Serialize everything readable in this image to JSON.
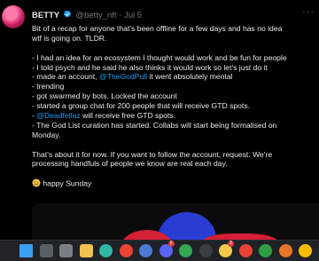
{
  "tweet": {
    "display_name": "BETTY",
    "handle": "@betty_nft",
    "separator": "·",
    "date": "Jul 5",
    "more_label": "···",
    "lines": [
      {
        "parts": [
          {
            "text": "Bit of a recap for anyone that's been offline for a few days and has no idea"
          }
        ]
      },
      {
        "parts": [
          {
            "text": "wtf is going on. TLDR."
          }
        ]
      },
      {
        "blank": true
      },
      {
        "parts": [
          {
            "text": "- I had an idea for an ecosystem I thought would work and be fun for people"
          }
        ]
      },
      {
        "parts": [
          {
            "text": "- I told psych and he said he also thinks it would work so let's just do it"
          }
        ]
      },
      {
        "parts": [
          {
            "text": "- made an account, "
          },
          {
            "text": "@TheGodPull",
            "mention": true
          },
          {
            "text": " it went absolutely mental"
          }
        ]
      },
      {
        "parts": [
          {
            "text": "- trending"
          }
        ]
      },
      {
        "parts": [
          {
            "text": "- got swarmed by bots. Locked the account"
          }
        ]
      },
      {
        "parts": [
          {
            "text": "- started a group chat for 200 people that will receive GTD spots."
          }
        ]
      },
      {
        "parts": [
          {
            "text": "- "
          },
          {
            "text": "@Deadfellaz",
            "mention": true
          },
          {
            "text": " will receive free GTD spots."
          }
        ]
      },
      {
        "parts": [
          {
            "text": "- The God List curation has started. Collabs will start being formalised on"
          }
        ]
      },
      {
        "parts": [
          {
            "text": "Monday."
          }
        ]
      },
      {
        "blank": true
      },
      {
        "parts": [
          {
            "text": "That's about it for now. If you want to follow the account, request. We're"
          }
        ]
      },
      {
        "parts": [
          {
            "text": "processing handfuls of people we know are real each day."
          }
        ]
      },
      {
        "blank": true
      },
      {
        "emoji": "smiling-face-emoji",
        "parts": [
          {
            "text": "happy Sunday"
          }
        ]
      }
    ]
  },
  "taskbar": {
    "icons": [
      {
        "name": "windows-start-icon",
        "color": "#3aa0f2",
        "badge": ""
      },
      {
        "name": "search-icon",
        "color": "#5a5f66",
        "badge": ""
      },
      {
        "name": "task-view-icon",
        "color": "#7a7f86",
        "badge": ""
      },
      {
        "name": "file-explorer-icon",
        "color": "#f2c14e",
        "badge": ""
      },
      {
        "name": "edge-browser-icon",
        "color": "#2fb8a3",
        "badge": ""
      },
      {
        "name": "chrome-browser-icon",
        "color": "#ea4335",
        "badge": ""
      },
      {
        "name": "app-icon-blue",
        "color": "#4a7bd6",
        "badge": ""
      },
      {
        "name": "discord-icon",
        "color": "#5865f2",
        "badge": "9"
      },
      {
        "name": "chrome-profile-icon",
        "color": "#34a853",
        "badge": ""
      },
      {
        "name": "app-icon-dark",
        "color": "#3a3d42",
        "badge": ""
      },
      {
        "name": "app-icon-yellow",
        "color": "#f7c948",
        "badge": "2"
      },
      {
        "name": "chrome-profile-2-icon",
        "color": "#ea4335",
        "badge": ""
      },
      {
        "name": "app-icon-green",
        "color": "#2ea043",
        "badge": ""
      },
      {
        "name": "app-icon-orange",
        "color": "#e8742a",
        "badge": ""
      },
      {
        "name": "chrome-profile-3-icon",
        "color": "#fbbc05",
        "badge": ""
      }
    ]
  },
  "colors": {
    "background": "#000000",
    "text": "#e7e9ea",
    "secondary_text": "#71767b",
    "mention": "#1d9bf0",
    "verified": "#1d9bf0",
    "taskbar": "#1f2227"
  }
}
